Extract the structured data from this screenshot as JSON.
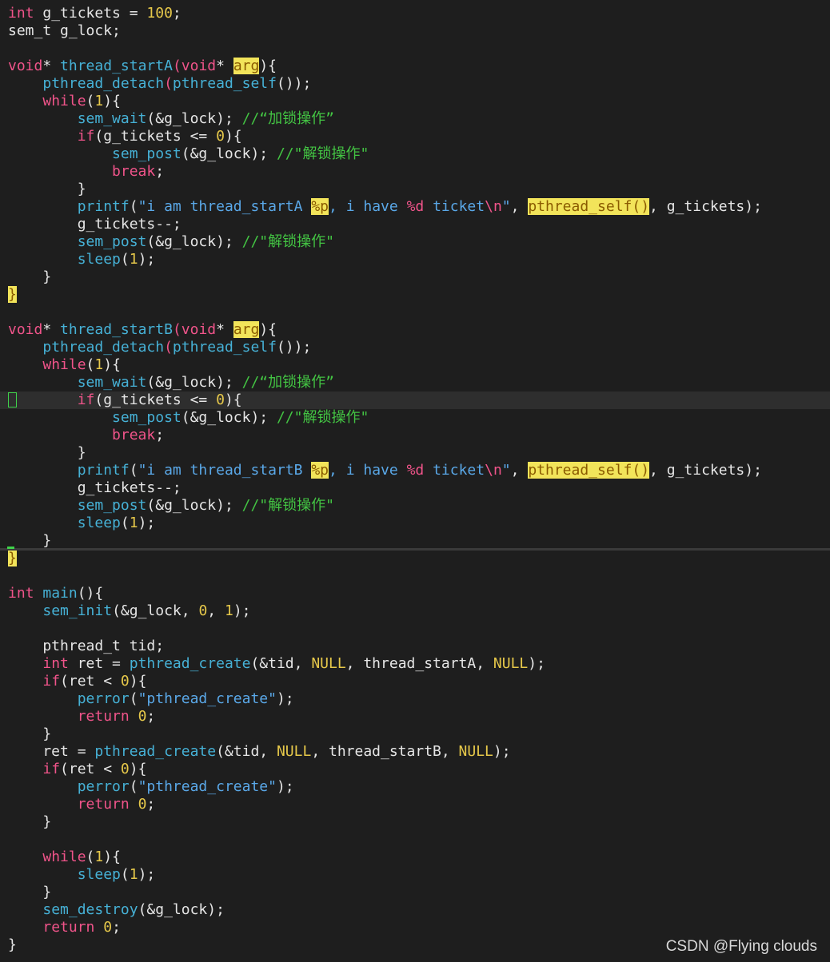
{
  "editor": {
    "cursor_line": 22,
    "lines": [
      [
        [
          "int",
          "k"
        ],
        [
          " g_tickets = ",
          ""
        ],
        [
          "100",
          "n"
        ],
        [
          ";",
          ""
        ]
      ],
      [
        [
          "sem_t g_lock;",
          ""
        ]
      ],
      [],
      [
        [
          "void",
          "k"
        ],
        [
          "* ",
          ""
        ],
        [
          "thread_startA",
          "f"
        ],
        [
          "(",
          "k"
        ],
        [
          "void",
          "k"
        ],
        [
          "* ",
          ""
        ],
        [
          "arg",
          "h"
        ],
        [
          "){",
          ""
        ]
      ],
      [
        [
          "    ",
          ""
        ],
        [
          "pthread_detach",
          "f"
        ],
        [
          "(",
          "k"
        ],
        [
          "pthread_self",
          "f"
        ],
        [
          "());",
          ""
        ]
      ],
      [
        [
          "    ",
          ""
        ],
        [
          "while",
          "k"
        ],
        [
          "(",
          ""
        ],
        [
          "1",
          "n"
        ],
        [
          "){",
          ""
        ]
      ],
      [
        [
          "        ",
          ""
        ],
        [
          "sem_wait",
          "f"
        ],
        [
          "(&g_lock); ",
          ""
        ],
        [
          "//“加锁操作”",
          "c"
        ]
      ],
      [
        [
          "        ",
          ""
        ],
        [
          "if",
          "k"
        ],
        [
          "(g_tickets <= ",
          ""
        ],
        [
          "0",
          "n"
        ],
        [
          "){",
          ""
        ]
      ],
      [
        [
          "            ",
          ""
        ],
        [
          "sem_post",
          "f"
        ],
        [
          "(&g_lock); ",
          ""
        ],
        [
          "//\"解锁操作\"",
          "c"
        ]
      ],
      [
        [
          "            ",
          ""
        ],
        [
          "break",
          "k"
        ],
        [
          ";",
          ""
        ]
      ],
      [
        [
          "        }",
          ""
        ]
      ],
      [
        [
          "        ",
          ""
        ],
        [
          "printf",
          "f"
        ],
        [
          "(",
          ""
        ],
        [
          "\"i am thread_startA ",
          "s"
        ],
        [
          "%p",
          "hb"
        ],
        [
          ", i have ",
          "s"
        ],
        [
          "%d",
          "e"
        ],
        [
          " ticket",
          "s"
        ],
        [
          "\\n",
          "e"
        ],
        [
          "\"",
          "s"
        ],
        [
          ", ",
          ""
        ],
        [
          "pthread_self()",
          "h"
        ],
        [
          ", g_tickets);",
          ""
        ]
      ],
      [
        [
          "        g_tickets--;",
          ""
        ]
      ],
      [
        [
          "        ",
          ""
        ],
        [
          "sem_post",
          "f"
        ],
        [
          "(&g_lock); ",
          ""
        ],
        [
          "//\"解锁操作\"",
          "c"
        ]
      ],
      [
        [
          "        ",
          ""
        ],
        [
          "sleep",
          "f"
        ],
        [
          "(",
          ""
        ],
        [
          "1",
          "n"
        ],
        [
          ");",
          ""
        ]
      ],
      [
        [
          "    }",
          ""
        ]
      ],
      [
        [
          "}",
          "h"
        ]
      ],
      [],
      [
        [
          "void",
          "k"
        ],
        [
          "* ",
          ""
        ],
        [
          "thread_startB",
          "f"
        ],
        [
          "(",
          "k"
        ],
        [
          "void",
          "k"
        ],
        [
          "* ",
          ""
        ],
        [
          "arg",
          "h"
        ],
        [
          "){",
          ""
        ]
      ],
      [
        [
          "    ",
          ""
        ],
        [
          "pthread_detach",
          "f"
        ],
        [
          "(",
          "k"
        ],
        [
          "pthread_self",
          "f"
        ],
        [
          "());",
          ""
        ]
      ],
      [
        [
          "    ",
          ""
        ],
        [
          "while",
          "k"
        ],
        [
          "(",
          ""
        ],
        [
          "1",
          "n"
        ],
        [
          "){",
          ""
        ]
      ],
      [
        [
          "        ",
          ""
        ],
        [
          "sem_wait",
          "f"
        ],
        [
          "(&g_lock); ",
          ""
        ],
        [
          "//“加锁操作”",
          "c"
        ]
      ],
      [
        [
          "        ",
          ""
        ],
        [
          "if",
          "k"
        ],
        [
          "(g_tickets <= ",
          ""
        ],
        [
          "0",
          "n"
        ],
        [
          "){",
          ""
        ]
      ],
      [
        [
          "            ",
          ""
        ],
        [
          "sem_post",
          "f"
        ],
        [
          "(&g_lock); ",
          ""
        ],
        [
          "//\"解锁操作\"",
          "c"
        ]
      ],
      [
        [
          "            ",
          ""
        ],
        [
          "break",
          "k"
        ],
        [
          ";",
          ""
        ]
      ],
      [
        [
          "        }",
          ""
        ]
      ],
      [
        [
          "        ",
          ""
        ],
        [
          "printf",
          "f"
        ],
        [
          "(",
          ""
        ],
        [
          "\"i am thread_startB ",
          "s"
        ],
        [
          "%p",
          "hb"
        ],
        [
          ", i have ",
          "s"
        ],
        [
          "%d",
          "e"
        ],
        [
          " ticket",
          "s"
        ],
        [
          "\\n",
          "e"
        ],
        [
          "\"",
          "s"
        ],
        [
          ", ",
          ""
        ],
        [
          "pthread_self()",
          "h"
        ],
        [
          ", g_tickets);",
          ""
        ]
      ],
      [
        [
          "        g_tickets--;",
          ""
        ]
      ],
      [
        [
          "        ",
          ""
        ],
        [
          "sem_post",
          "f"
        ],
        [
          "(&g_lock); ",
          ""
        ],
        [
          "//\"解锁操作\"",
          "c"
        ]
      ],
      [
        [
          "        ",
          ""
        ],
        [
          "sleep",
          "f"
        ],
        [
          "(",
          ""
        ],
        [
          "1",
          "n"
        ],
        [
          ");",
          ""
        ]
      ],
      [
        [
          "    }",
          ""
        ]
      ],
      [
        [
          "}",
          "h"
        ]
      ],
      [],
      [
        [
          "int",
          "k"
        ],
        [
          " ",
          ""
        ],
        [
          "main",
          "f"
        ],
        [
          "(){",
          ""
        ]
      ],
      [
        [
          "    ",
          ""
        ],
        [
          "sem_init",
          "f"
        ],
        [
          "(&g_lock, ",
          ""
        ],
        [
          "0",
          "n"
        ],
        [
          ", ",
          ""
        ],
        [
          "1",
          "n"
        ],
        [
          ");",
          ""
        ]
      ],
      [],
      [
        [
          "    pthread_t tid;",
          ""
        ]
      ],
      [
        [
          "    ",
          ""
        ],
        [
          "int",
          "k"
        ],
        [
          " ret = ",
          ""
        ],
        [
          "pthread_create",
          "f"
        ],
        [
          "(&tid, ",
          ""
        ],
        [
          "NULL",
          "n"
        ],
        [
          ", thread_startA, ",
          ""
        ],
        [
          "NULL",
          "n"
        ],
        [
          ");",
          ""
        ]
      ],
      [
        [
          "    ",
          ""
        ],
        [
          "if",
          "k"
        ],
        [
          "(ret < ",
          ""
        ],
        [
          "0",
          "n"
        ],
        [
          "){",
          ""
        ]
      ],
      [
        [
          "        ",
          ""
        ],
        [
          "perror",
          "f"
        ],
        [
          "(",
          ""
        ],
        [
          "\"pthread_create\"",
          "s"
        ],
        [
          ");",
          ""
        ]
      ],
      [
        [
          "        ",
          ""
        ],
        [
          "return",
          "k"
        ],
        [
          " ",
          ""
        ],
        [
          "0",
          "n"
        ],
        [
          ";",
          ""
        ]
      ],
      [
        [
          "    }",
          ""
        ]
      ],
      [
        [
          "    ret = ",
          ""
        ],
        [
          "pthread_create",
          "f"
        ],
        [
          "(&tid, ",
          ""
        ],
        [
          "NULL",
          "n"
        ],
        [
          ", thread_startB, ",
          ""
        ],
        [
          "NULL",
          "n"
        ],
        [
          ");",
          ""
        ]
      ],
      [
        [
          "    ",
          ""
        ],
        [
          "if",
          "k"
        ],
        [
          "(ret < ",
          ""
        ],
        [
          "0",
          "n"
        ],
        [
          "){",
          ""
        ]
      ],
      [
        [
          "        ",
          ""
        ],
        [
          "perror",
          "f"
        ],
        [
          "(",
          ""
        ],
        [
          "\"pthread_create\"",
          "s"
        ],
        [
          ");",
          ""
        ]
      ],
      [
        [
          "        ",
          ""
        ],
        [
          "return",
          "k"
        ],
        [
          " ",
          ""
        ],
        [
          "0",
          "n"
        ],
        [
          ";",
          ""
        ]
      ],
      [
        [
          "    }",
          ""
        ]
      ],
      [],
      [
        [
          "    ",
          ""
        ],
        [
          "while",
          "k"
        ],
        [
          "(",
          ""
        ],
        [
          "1",
          "n"
        ],
        [
          "){",
          ""
        ]
      ],
      [
        [
          "        ",
          ""
        ],
        [
          "sleep",
          "f"
        ],
        [
          "(",
          ""
        ],
        [
          "1",
          "n"
        ],
        [
          ");",
          ""
        ]
      ],
      [
        [
          "    }",
          ""
        ]
      ],
      [
        [
          "    ",
          ""
        ],
        [
          "sem_destroy",
          "f"
        ],
        [
          "(&g_lock);",
          ""
        ]
      ],
      [
        [
          "    ",
          ""
        ],
        [
          "return",
          "k"
        ],
        [
          " ",
          ""
        ],
        [
          "0",
          "n"
        ],
        [
          ";",
          ""
        ]
      ],
      [
        [
          "}",
          ""
        ]
      ]
    ]
  },
  "watermark": "CSDN @Flying  clouds"
}
